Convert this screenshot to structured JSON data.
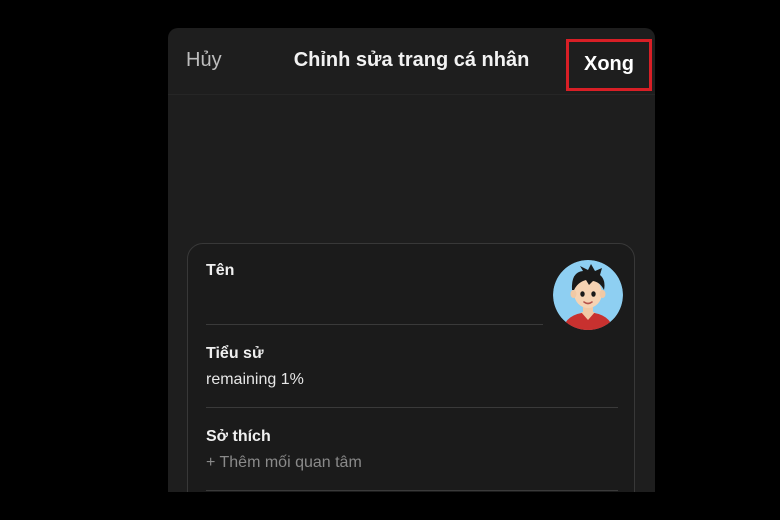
{
  "header": {
    "cancel_label": "Hủy",
    "title": "Chỉnh sửa trang cá nhân",
    "done_label": "Xong"
  },
  "profile": {
    "name": {
      "label": "Tên",
      "value": ""
    },
    "bio": {
      "label": "Tiểu sử",
      "value": "remaining 1%"
    },
    "interests": {
      "label": "Sở thích",
      "placeholder": "+ Thêm mối quan tâm"
    },
    "avatar_icon": "cartoon-boy-avatar"
  },
  "colors": {
    "page_background": "#000000",
    "panel_background": "#1e1e1e",
    "highlight_border": "#d81f26",
    "avatar_background": "#8ecff2",
    "avatar_shirt": "#c8312f"
  }
}
